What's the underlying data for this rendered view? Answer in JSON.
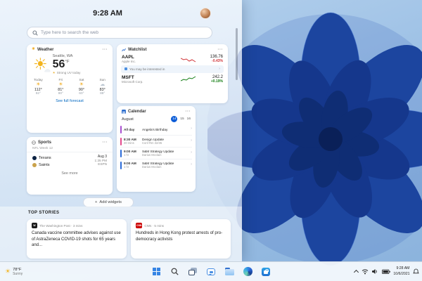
{
  "panel": {
    "time": "9:28 AM",
    "search_placeholder": "Type here to search the web",
    "add_widgets": "Add widgets",
    "top_stories_label": "TOP STORIES"
  },
  "weather": {
    "title": "Weather",
    "location": "Seattle, WA",
    "temp": "56",
    "unit": "°F",
    "condition": "Strong UV today",
    "link": "See full forecast",
    "forecast": [
      {
        "day": "Today",
        "hi": "112°",
        "lo": "92°"
      },
      {
        "day": "Fri",
        "hi": "81°",
        "lo": "80°"
      },
      {
        "day": "Sat",
        "hi": "90°",
        "lo": "60°"
      },
      {
        "day": "Sun",
        "hi": "83°",
        "lo": "88°"
      }
    ]
  },
  "watchlist": {
    "title": "Watchlist",
    "suggestion": "You may be interested in",
    "stocks": [
      {
        "symbol": "AAPL",
        "name": "Apple Inc.",
        "price": "136.76",
        "change": "-0.43%"
      },
      {
        "symbol": "MSFT",
        "name": "Microsoft Corp.",
        "price": "242.2",
        "change": "+0.19%"
      }
    ]
  },
  "calendar": {
    "title": "Calendar",
    "month": "August",
    "days": [
      "14",
      "15",
      "16"
    ],
    "events": [
      {
        "time": "All day",
        "dur": "",
        "title": "Angela's Birthday",
        "sub": "",
        "color": "#a94fd0"
      },
      {
        "time": "8:30 AM",
        "dur": "20 mins",
        "title": "Design Update",
        "sub": "Conf Rm 32/35",
        "color": "#e3498c"
      },
      {
        "time": "9:00 AM",
        "dur": "1 hr",
        "title": "S&M Strategy Update",
        "sub": "Darius Mcclain",
        "color": "#2b6bd8"
      },
      {
        "time": "9:00 AM",
        "dur": "1 hr",
        "title": "S&M Strategy Update",
        "sub": "Darius Mcclain",
        "color": "#2b6bd8"
      }
    ]
  },
  "sports": {
    "title": "Sports",
    "league": "NFL Week 12",
    "teams": [
      {
        "name": "Texans",
        "color": "#0b2242"
      },
      {
        "name": "Saints",
        "color": "#c9a24b"
      }
    ],
    "date": "Aug 3",
    "time": "1:25 PM",
    "network": "ESPN",
    "link": "See more"
  },
  "stories": [
    {
      "badge": "W",
      "badge_bg": "#1b1b1b",
      "attribution": "The Washington Post · 3 mins",
      "headline": "Canada vaccine committee advises against use of AstraZeneca COVID-19 shots for 65 years and..."
    },
    {
      "badge": "CNN",
      "badge_bg": "#cc0000",
      "attribution": "CNN · 5 mins",
      "headline": "Hundreds in Hong Kong protest arrests of pro-democracy activists"
    }
  ],
  "taskbar": {
    "weather_temp": "78°F",
    "weather_cond": "Sunny",
    "time": "9:28 AM",
    "date": "10/6/2021"
  },
  "icons": {
    "more": "···",
    "sun": "☀",
    "cloud": "☁",
    "chevron_right": "›",
    "plus": "+"
  },
  "colors": {
    "accent": "#0067c0",
    "selected_day": "#0b5cd7",
    "positive": "#0f7b0f",
    "negative": "#d13438"
  }
}
